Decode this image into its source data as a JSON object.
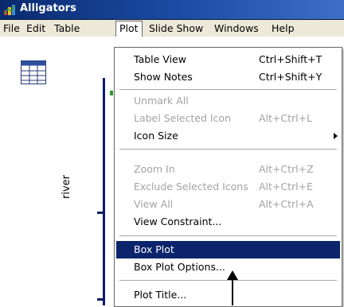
{
  "window": {
    "title": "Alligators",
    "app_icon": "app-icon"
  },
  "menubar": {
    "items": [
      "File",
      "Edit",
      "Table",
      "Plot",
      "Slide Show",
      "Windows",
      "Help"
    ],
    "active": "Plot"
  },
  "content": {
    "table_icon": "table-icon",
    "axis_label": "river"
  },
  "plot_menu": {
    "items": [
      {
        "label": "Table View",
        "shortcut": "Ctrl+Shift+T",
        "state": "enabled"
      },
      {
        "label": "Show Notes",
        "shortcut": "Ctrl+Shift+Y",
        "state": "enabled"
      },
      {
        "label": "Unmark All",
        "shortcut": "",
        "state": "disabled"
      },
      {
        "label": "Label Selected Icon",
        "shortcut": "Alt+Ctrl+L",
        "state": "disabled"
      },
      {
        "label": "Icon Size",
        "shortcut": "",
        "state": "enabled",
        "submenu": true
      },
      {
        "label": "Zoom In",
        "shortcut": "Alt+Ctrl+Z",
        "state": "disabled"
      },
      {
        "label": "Exclude Selected Icons",
        "shortcut": "Alt+Ctrl+E",
        "state": "disabled"
      },
      {
        "label": "View All",
        "shortcut": "Alt+Ctrl+A",
        "state": "disabled"
      },
      {
        "label": "View Constraint...",
        "shortcut": "",
        "state": "enabled"
      },
      {
        "label": "Box Plot",
        "shortcut": "",
        "state": "selected"
      },
      {
        "label": "Box Plot Options...",
        "shortcut": "",
        "state": "enabled"
      },
      {
        "label": "Plot Title...",
        "shortcut": "",
        "state": "enabled"
      }
    ]
  },
  "colors": {
    "titlebar": "#0a2a6e",
    "selection": "#0b246b",
    "axis": "#0b1d6a",
    "disabled_text": "#a3a3a3"
  }
}
